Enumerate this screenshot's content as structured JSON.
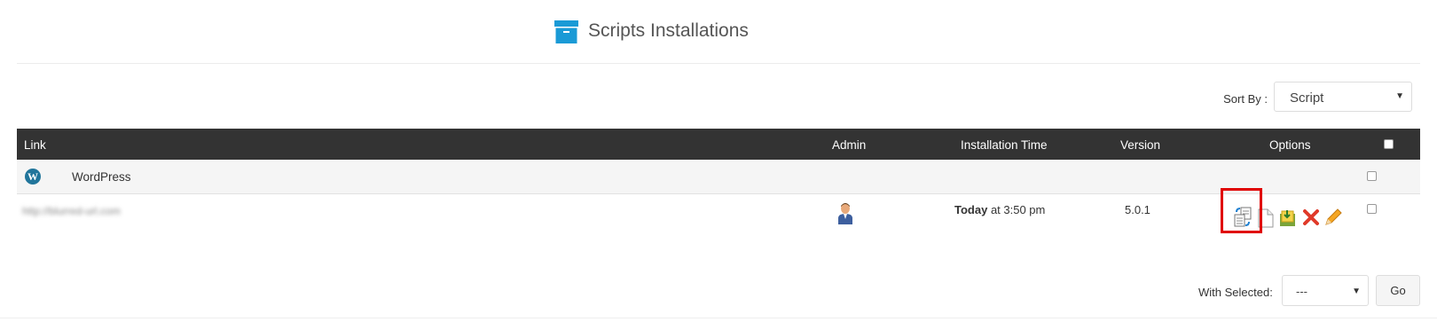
{
  "page": {
    "title": "Scripts Installations"
  },
  "sort": {
    "label": "Sort By :",
    "value": "Script"
  },
  "table": {
    "columns": {
      "link": "Link",
      "admin": "Admin",
      "installation_time": "Installation Time",
      "version": "Version",
      "options": "Options"
    },
    "groups": [
      {
        "name": "WordPress",
        "rows": [
          {
            "link": "http://blurred-url.com",
            "time_bold": "Today",
            "time_rest": " at 3:50 pm",
            "version": "5.0.1"
          }
        ]
      }
    ]
  },
  "icons": {
    "admin": "admin-user-icon",
    "group": "wordpress-logo-icon",
    "options": [
      "clone-icon",
      "copy-icon",
      "import-icon",
      "remove-icon",
      "edit-icon"
    ]
  },
  "colors": {
    "header_bg": "#333333",
    "highlight": "#e00000",
    "brand": "#21759b",
    "title_icon": "#1a9ad6"
  },
  "bulk": {
    "label": "With Selected:",
    "value": "---",
    "go_label": "Go"
  }
}
